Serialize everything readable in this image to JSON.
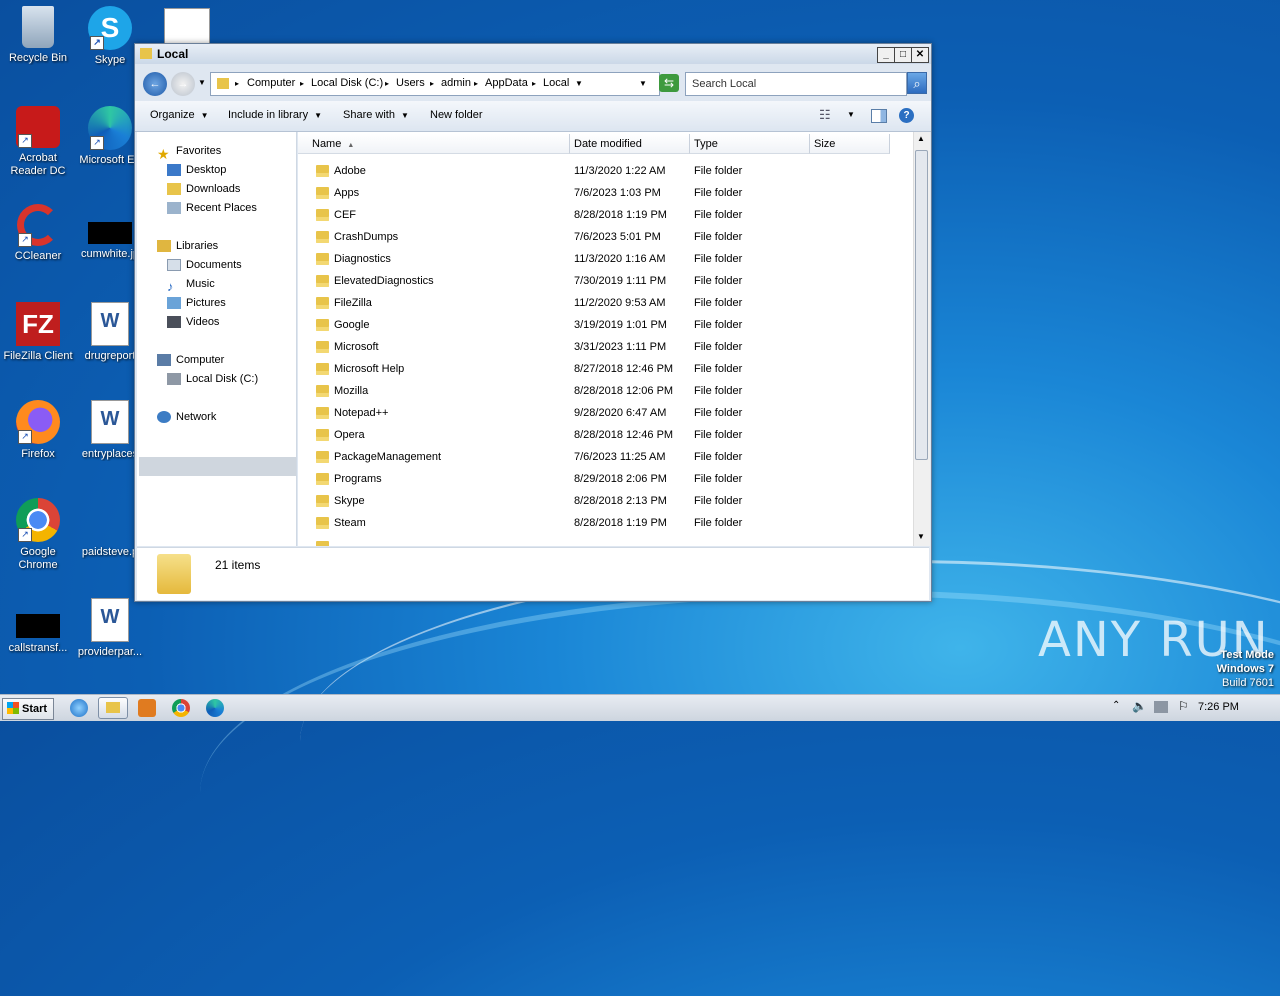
{
  "desktop": {
    "icons": [
      {
        "label": "Recycle Bin"
      },
      {
        "label": "Skype"
      },
      {
        "label": "Acrobat Reader DC"
      },
      {
        "label": "Microsoft Edge"
      },
      {
        "label": "CCleaner"
      },
      {
        "label": "cumwhite.jpg"
      },
      {
        "label": "FileZilla Client"
      },
      {
        "label": "drugreport"
      },
      {
        "label": "Firefox"
      },
      {
        "label": "entryplaces"
      },
      {
        "label": "Google Chrome"
      },
      {
        "label": "paidsteve.p"
      },
      {
        "label": "callstransf..."
      },
      {
        "label": "providerpar..."
      }
    ],
    "acrobat_line1": "Acrobat",
    "acrobat_line2": "Reader DC",
    "edge_label": "Microsoft Ed",
    "chrome_line1": "Google",
    "chrome_line2": "Chrome",
    "cumwhite_label": "cumwhite.jp",
    "watermark": {
      "line1": "Test Mode",
      "line2": "Windows 7",
      "line3": "Build 7601"
    },
    "brand": "ANY RUN"
  },
  "window": {
    "title": "Local",
    "breadcrumbs": [
      "Computer",
      "Local Disk (C:)",
      "Users",
      "admin",
      "AppData",
      "Local"
    ],
    "search_placeholder": "Search Local",
    "toolbar": {
      "organize": "Organize",
      "include_in_library": "Include in library",
      "share_with": "Share with",
      "new_folder": "New folder"
    },
    "nav": {
      "favorites": "Favorites",
      "desktop": "Desktop",
      "downloads": "Downloads",
      "recent_places": "Recent Places",
      "libraries": "Libraries",
      "documents": "Documents",
      "music": "Music",
      "pictures": "Pictures",
      "videos": "Videos",
      "computer": "Computer",
      "local_disk": "Local Disk (C:)",
      "network": "Network"
    },
    "columns": {
      "name": "Name",
      "date_modified": "Date modified",
      "type": "Type",
      "size": "Size"
    },
    "files": [
      {
        "name": "Adobe",
        "date": "11/3/2020 1:22 AM",
        "type": "File folder"
      },
      {
        "name": "Apps",
        "date": "7/6/2023 1:03 PM",
        "type": "File folder"
      },
      {
        "name": "CEF",
        "date": "8/28/2018 1:19 PM",
        "type": "File folder"
      },
      {
        "name": "CrashDumps",
        "date": "7/6/2023 5:01 PM",
        "type": "File folder"
      },
      {
        "name": "Diagnostics",
        "date": "11/3/2020 1:16 AM",
        "type": "File folder"
      },
      {
        "name": "ElevatedDiagnostics",
        "date": "7/30/2019 1:11 PM",
        "type": "File folder"
      },
      {
        "name": "FileZilla",
        "date": "11/2/2020 9:53 AM",
        "type": "File folder"
      },
      {
        "name": "Google",
        "date": "3/19/2019 1:01 PM",
        "type": "File folder"
      },
      {
        "name": "Microsoft",
        "date": "3/31/2023 1:11 PM",
        "type": "File folder"
      },
      {
        "name": "Microsoft Help",
        "date": "8/27/2018 12:46 PM",
        "type": "File folder"
      },
      {
        "name": "Mozilla",
        "date": "8/28/2018 12:06 PM",
        "type": "File folder"
      },
      {
        "name": "Notepad++",
        "date": "9/28/2020 6:47 AM",
        "type": "File folder"
      },
      {
        "name": "Opera",
        "date": "8/28/2018 12:46 PM",
        "type": "File folder"
      },
      {
        "name": "PackageManagement",
        "date": "7/6/2023 11:25 AM",
        "type": "File folder"
      },
      {
        "name": "Programs",
        "date": "8/29/2018 2:06 PM",
        "type": "File folder"
      },
      {
        "name": "Skype",
        "date": "8/28/2018 2:13 PM",
        "type": "File folder"
      },
      {
        "name": "Steam",
        "date": "8/28/2018 1:19 PM",
        "type": "File folder"
      }
    ],
    "status": "21 items"
  },
  "taskbar": {
    "start": "Start",
    "clock": "7:26 PM"
  }
}
